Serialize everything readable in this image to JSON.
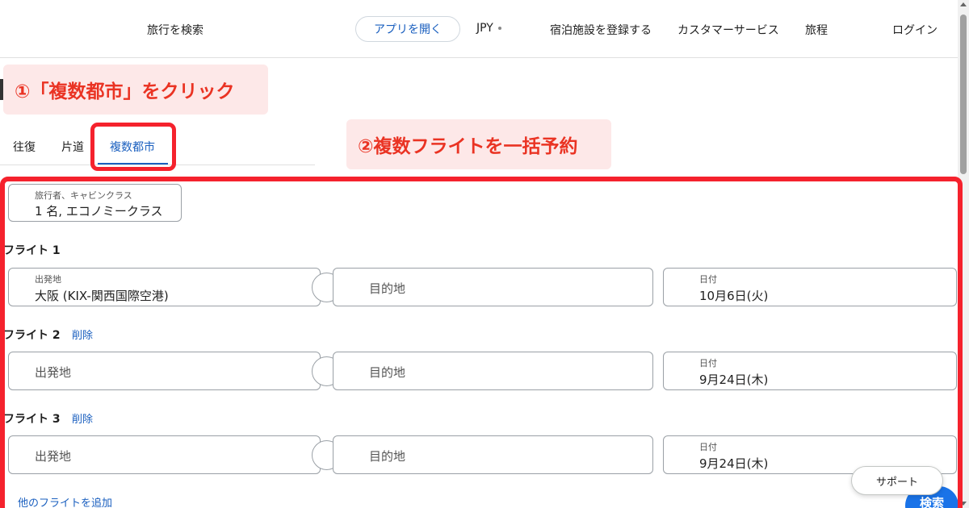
{
  "header": {
    "search_trips": "旅行を検索",
    "open_app": "アプリを開く",
    "currency": "JPY",
    "register_property": "宿泊施設を登録する",
    "customer_service": "カスタマーサービス",
    "trips": "旅程",
    "login": "ログイン"
  },
  "annotations": {
    "step1": "①「複数都市」をクリック",
    "step2": "②複数フライトを一括予約",
    "highlight_color": "#f5222d",
    "text_color": "#ea3323"
  },
  "tabs": {
    "round_trip": "往復",
    "one_way": "片道",
    "multi_city": "複数都市",
    "active": "multi_city"
  },
  "travelers": {
    "label": "旅行者、キャビンクラス",
    "value": "1 名, エコノミークラス"
  },
  "flights": [
    {
      "heading": "フライト 1",
      "origin_label": "出発地",
      "origin_value": "大阪 (KIX-関西国際空港)",
      "destination_placeholder": "目的地",
      "date_label": "日付",
      "date_value": "10月6日(火)"
    },
    {
      "heading": "フライト 2",
      "delete_label": "削除",
      "origin_placeholder": "出発地",
      "destination_placeholder": "目的地",
      "date_label": "日付",
      "date_value": "9月24日(木)"
    },
    {
      "heading": "フライト 3",
      "delete_label": "削除",
      "origin_placeholder": "出発地",
      "destination_placeholder": "目的地",
      "date_label": "日付",
      "date_value": "9月24日(木)"
    }
  ],
  "add_flight": "他のフライトを追加",
  "support": "サポート",
  "search_button": "検索",
  "colors": {
    "accent": "#1a5fbf",
    "primary_button": "#1a73e8"
  }
}
